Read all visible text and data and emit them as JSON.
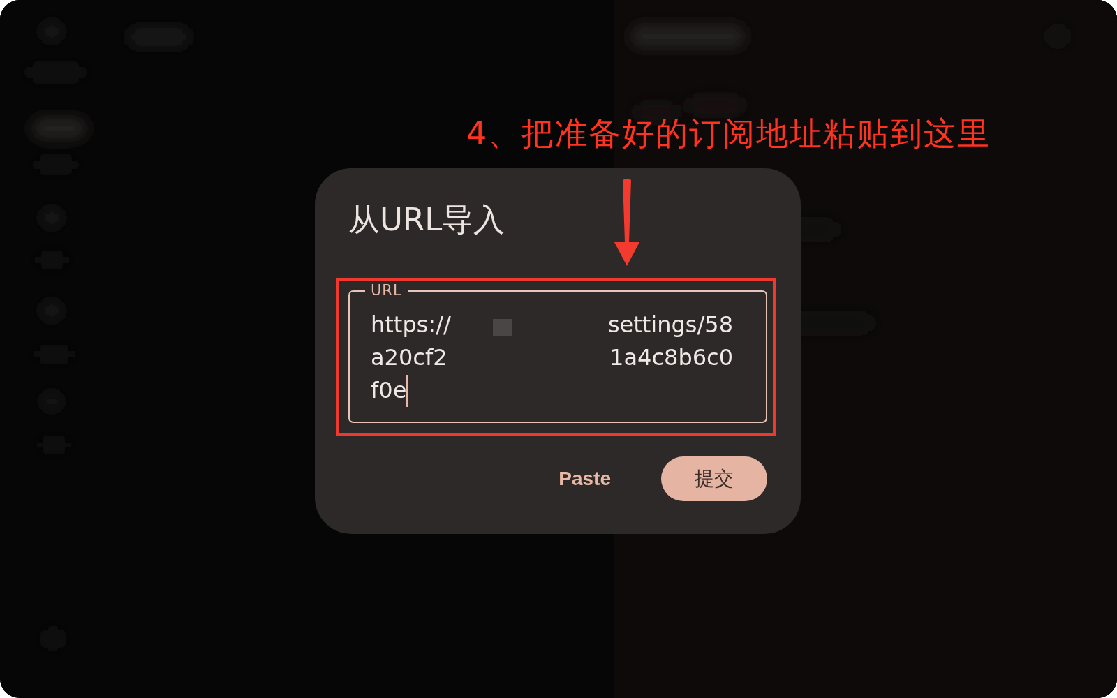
{
  "annotation": {
    "text": "4、把准备好的订阅地址粘贴到这里"
  },
  "dialog": {
    "title": "从URL导入",
    "url_field": {
      "label": "URL",
      "focused": true,
      "lines": [
        {
          "parts": [
            {
              "kind": "text",
              "text": "https://"
            },
            {
              "kind": "square"
            },
            {
              "kind": "text",
              "text": "settings/58"
            }
          ]
        },
        {
          "parts": [
            {
              "kind": "text",
              "text": "a20cf2"
            },
            {
              "kind": "blank"
            },
            {
              "kind": "text",
              "text": "1a4c8b6c0"
            }
          ]
        },
        {
          "parts": [
            {
              "kind": "text",
              "text": "f0e"
            }
          ]
        }
      ]
    },
    "buttons": [
      {
        "label": "Paste",
        "kind": "text"
      },
      {
        "label": "提交",
        "kind": "filled"
      }
    ]
  }
}
